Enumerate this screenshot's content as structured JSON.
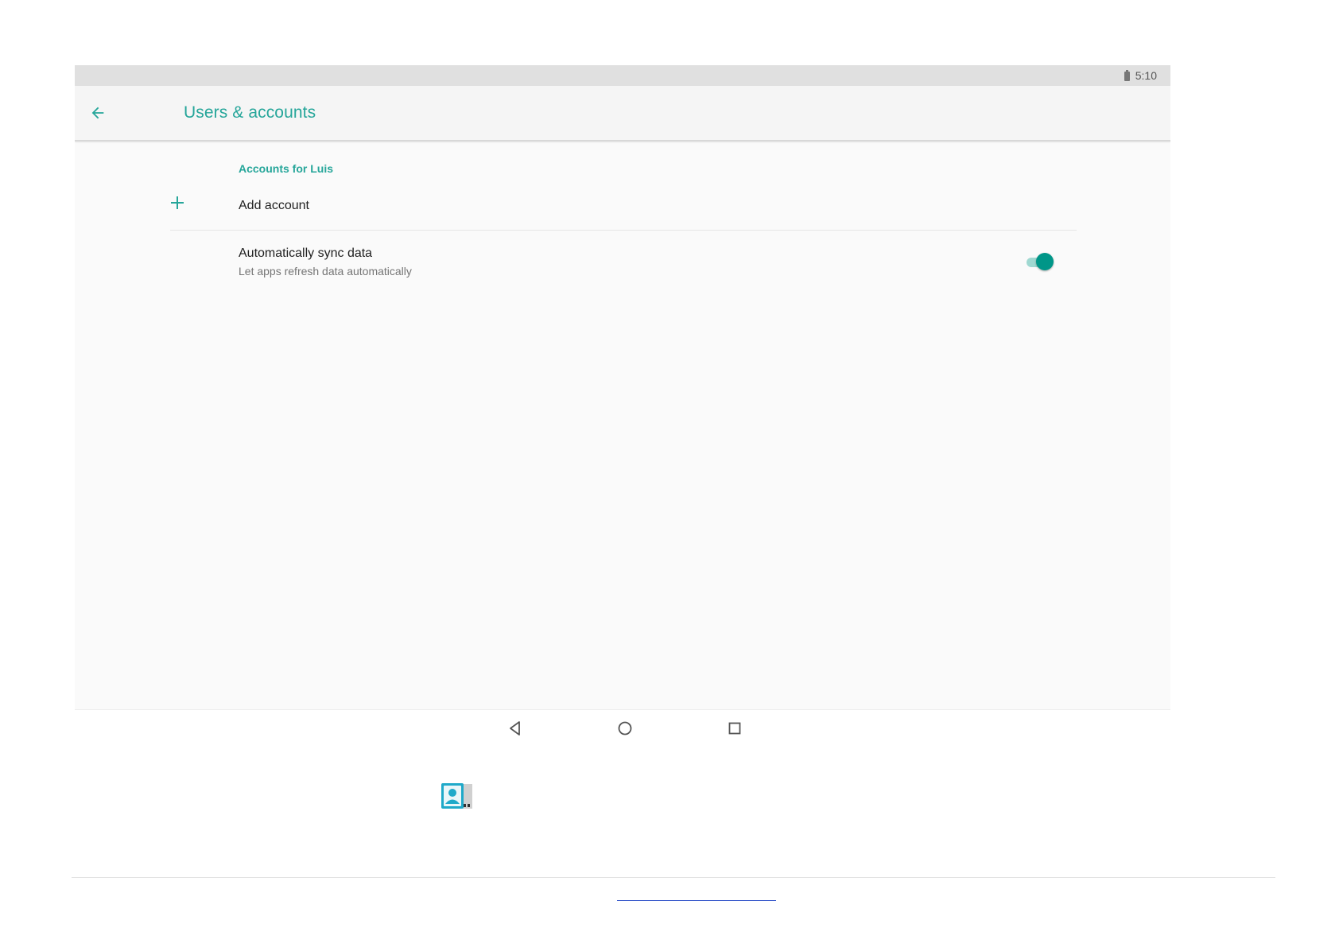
{
  "status_bar": {
    "time": "5:10",
    "battery_icon": "battery-icon"
  },
  "app_bar": {
    "back_icon": "arrow-back-icon",
    "title": "Users & accounts"
  },
  "accounts_section": {
    "header": "Accounts for Luis",
    "add_account": {
      "icon": "plus-icon",
      "label": "Add account"
    },
    "auto_sync": {
      "title": "Automatically sync data",
      "summary": "Let apps refresh data automatically",
      "enabled": true
    }
  },
  "navigation_bar": {
    "back_icon": "triangle-back-icon",
    "home_icon": "circle-home-icon",
    "recents_icon": "square-recents-icon"
  },
  "colors": {
    "accent": "#26a69a",
    "switch_thumb": "#009688",
    "switch_track": "#9fd8d1",
    "status_bar": "#e0e0e0",
    "app_bar": "#f5f5f5",
    "background": "#fafafa"
  }
}
